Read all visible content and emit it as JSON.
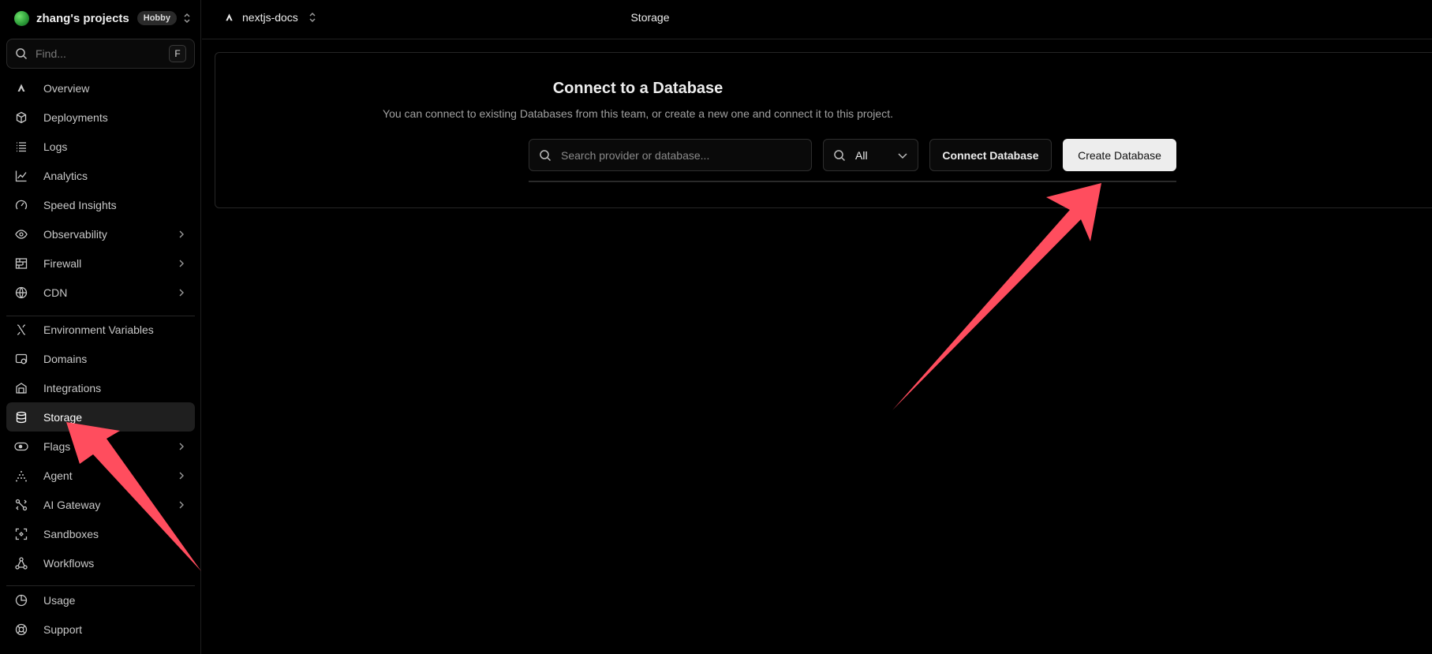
{
  "team": {
    "name": "zhang's projects",
    "badge": "Hobby"
  },
  "sidebar": {
    "search_placeholder": "Find...",
    "search_shortcut": "F",
    "items": [
      {
        "label": "Overview",
        "icon": "triangle-logo-icon"
      },
      {
        "label": "Deployments",
        "icon": "cube-icon"
      },
      {
        "label": "Logs",
        "icon": "list-icon"
      },
      {
        "label": "Analytics",
        "icon": "line-chart-icon"
      },
      {
        "label": "Speed Insights",
        "icon": "gauge-icon"
      },
      {
        "label": "Observability",
        "icon": "eye-icon"
      },
      {
        "label": "Firewall",
        "icon": "firewall-icon"
      },
      {
        "label": "CDN",
        "icon": "globe-icon"
      },
      {
        "label": "Environment Variables",
        "icon": "variables-icon"
      },
      {
        "label": "Domains",
        "icon": "domain-icon"
      },
      {
        "label": "Integrations",
        "icon": "integrations-icon"
      },
      {
        "label": "Storage",
        "icon": "database-icon"
      },
      {
        "label": "Flags",
        "icon": "toggle-icon"
      },
      {
        "label": "Agent",
        "icon": "agent-icon"
      },
      {
        "label": "AI Gateway",
        "icon": "gateway-icon"
      },
      {
        "label": "Sandboxes",
        "icon": "sandbox-icon"
      },
      {
        "label": "Workflows",
        "icon": "workflow-icon"
      },
      {
        "label": "Usage",
        "icon": "pie-icon"
      },
      {
        "label": "Support",
        "icon": "lifebuoy-icon"
      }
    ],
    "active": "Storage"
  },
  "topbar": {
    "project": "nextjs-docs",
    "page_title": "Storage"
  },
  "main": {
    "title": "Connect to a Database",
    "subtitle": "You can connect to existing Databases from this team, or create a new one and connect it to this project.",
    "search_placeholder": "Search provider or database...",
    "filter_value": "All",
    "connect_label": "Connect Database",
    "create_label": "Create Database"
  },
  "colors": {
    "annotation_arrow": "#ff4d5e",
    "background": "#000000",
    "active_item": "#1f1f1f"
  }
}
